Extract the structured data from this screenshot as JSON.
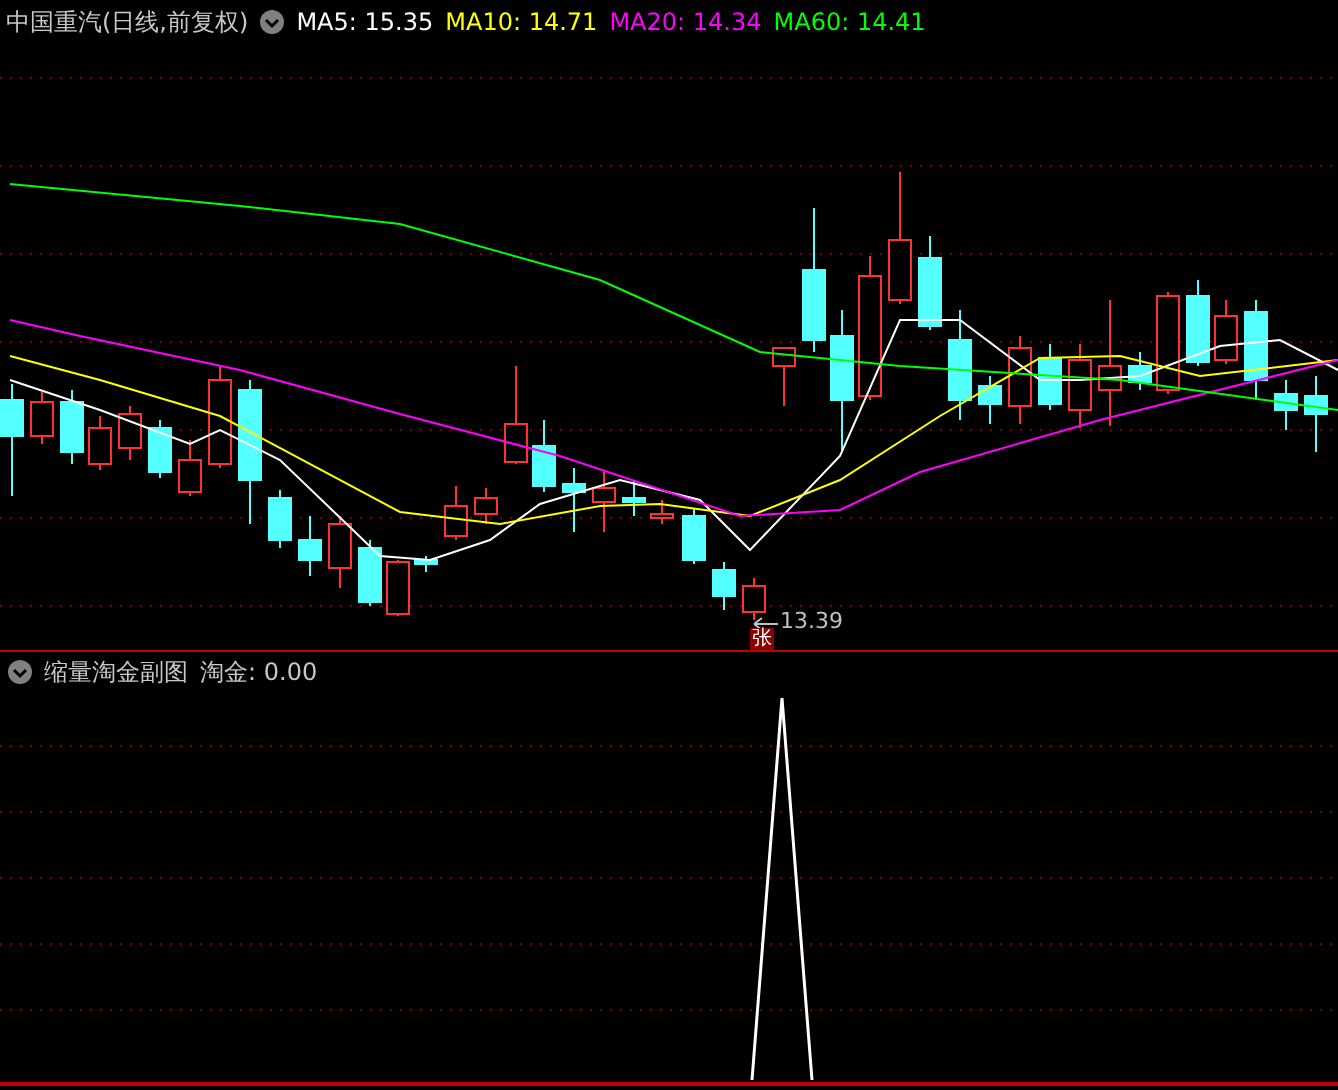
{
  "main_chart": {
    "title": "中国重汽(日线,前复权)",
    "indicators": [
      {
        "label": "MA5:",
        "value": "15.35",
        "color": "#ffffff"
      },
      {
        "label": "MA10:",
        "value": "14.71",
        "color": "#ffff00"
      },
      {
        "label": "MA20:",
        "value": "14.34",
        "color": "#ff00ff"
      },
      {
        "label": "MA60:",
        "value": "14.41",
        "color": "#00ff00"
      }
    ],
    "low_label": "13.39",
    "badge": "张"
  },
  "sub_chart": {
    "title": "缩量淘金副图",
    "indicator": {
      "label": "淘金:",
      "value": "0.00"
    }
  }
}
